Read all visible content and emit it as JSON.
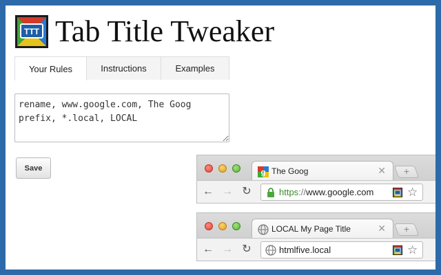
{
  "app": {
    "title": "Tab Title Tweaker",
    "logo_text": "TTT"
  },
  "tabs": [
    {
      "label": "Your Rules",
      "active": true
    },
    {
      "label": "Instructions",
      "active": false
    },
    {
      "label": "Examples",
      "active": false
    }
  ],
  "rules": {
    "value": "rename, www.google.com, The Goog\nprefix, *.local, LOCAL"
  },
  "save_label": "Save",
  "examples": [
    {
      "tab_title": "The Goog",
      "favicon": "google-favicon",
      "url_scheme": "https",
      "url_sep": "://",
      "url_host": "www.google.com",
      "secure": true
    },
    {
      "tab_title": "LOCAL My Page Title",
      "favicon": "globe-icon",
      "url_scheme": "",
      "url_sep": "",
      "url_host": "htmlfive.local",
      "secure": false
    }
  ],
  "colors": {
    "background": "#2d6aa9",
    "https_green": "#3a8a2a"
  }
}
